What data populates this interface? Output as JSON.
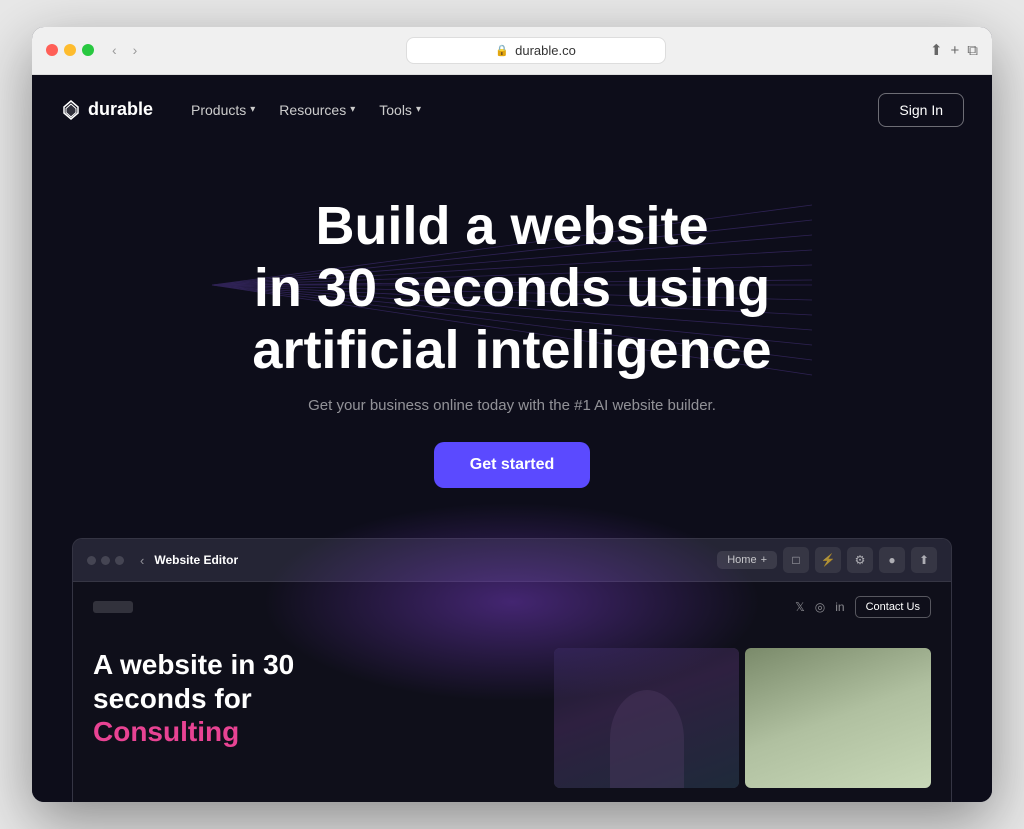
{
  "browser": {
    "url": "durable.co",
    "lock_icon": "🔒",
    "back_btn": "‹",
    "forward_btn": "›",
    "share_icon": "⬆",
    "new_tab_icon": "+",
    "copy_icon": "⧉"
  },
  "nav": {
    "logo_text": "durable",
    "links": [
      {
        "label": "Products",
        "has_dropdown": true
      },
      {
        "label": "Resources",
        "has_dropdown": true
      },
      {
        "label": "Tools",
        "has_dropdown": true
      }
    ],
    "sign_in": "Sign In"
  },
  "hero": {
    "title_line1": "Build a website",
    "title_line2": "in 30 seconds using",
    "title_line3": "artificial intelligence",
    "subtitle": "Get your business online today with the #1 AI website builder.",
    "cta_button": "Get started"
  },
  "preview": {
    "chrome": {
      "back": "‹",
      "title": "Website Editor",
      "tab_label": "Home",
      "tab_plus": "+",
      "icons": [
        "□",
        "⚡",
        "⚙",
        "●",
        "⬆"
      ]
    },
    "site": {
      "social_icons": [
        "𝕏",
        "◎",
        "in"
      ],
      "contact_btn": "Contact Us",
      "hero_title_line1": "A website in 30",
      "hero_title_line2": "seconds for",
      "hero_highlight": "Consulting"
    }
  }
}
